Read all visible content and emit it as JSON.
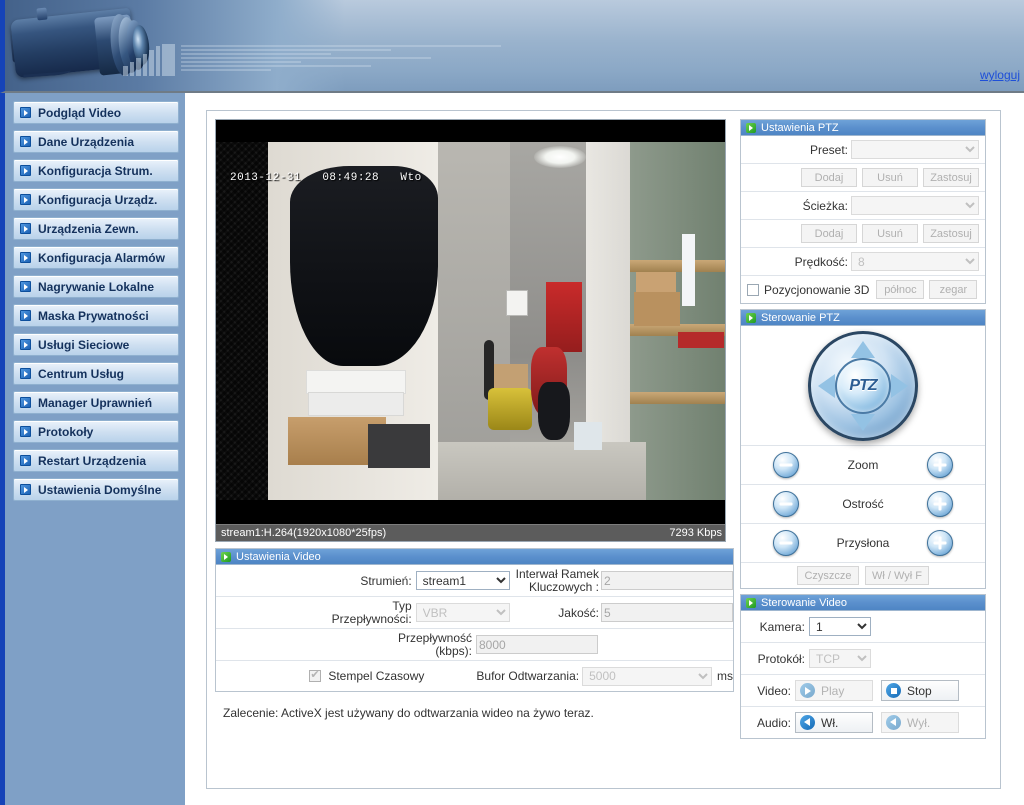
{
  "header": {
    "logo_icon": "camera-lens-image",
    "logout_label": "wyloguj"
  },
  "sidebar": {
    "items": [
      {
        "label": "Podgląd Video",
        "icon": "arrow-box-icon"
      },
      {
        "label": "Dane Urządzenia",
        "icon": "arrow-box-icon"
      },
      {
        "label": "Konfiguracja Strum.",
        "icon": "arrow-box-icon"
      },
      {
        "label": "Konfiguracja Urządz.",
        "icon": "arrow-box-icon"
      },
      {
        "label": "Urządzenia Zewn.",
        "icon": "arrow-box-icon"
      },
      {
        "label": "Konfiguracja Alarmów",
        "icon": "arrow-box-icon"
      },
      {
        "label": "Nagrywanie Lokalne",
        "icon": "arrow-box-icon"
      },
      {
        "label": "Maska Prywatności",
        "icon": "arrow-box-icon"
      },
      {
        "label": "Usługi Sieciowe",
        "icon": "arrow-box-icon"
      },
      {
        "label": "Centrum Usług",
        "icon": "arrow-box-icon"
      },
      {
        "label": "Manager Uprawnień",
        "icon": "arrow-box-icon"
      },
      {
        "label": "Protokoły",
        "icon": "arrow-box-icon"
      },
      {
        "label": "Restart Urządzenia",
        "icon": "arrow-box-icon"
      },
      {
        "label": "Ustawienia Domyślne",
        "icon": "arrow-box-icon"
      }
    ]
  },
  "video": {
    "timestamp_overlay": "2013-12-31   08:49:28   Wto",
    "stream_info": "stream1:H.264(1920x1080*25fps)",
    "bitrate": "7293 Kbps"
  },
  "ptz_settings": {
    "title": "Ustawienia PTZ",
    "preset_label": "Preset:",
    "preset_value": "",
    "preset_buttons": [
      "Dodaj",
      "Usuń",
      "Zastosuj"
    ],
    "path_label": "Ścieżka:",
    "path_value": "",
    "path_buttons": [
      "Dodaj",
      "Usuń",
      "Zastosuj"
    ],
    "speed_label": "Prędkość:",
    "speed_value": "8",
    "positioning_3d_label": "Pozycjonowanie 3D",
    "north_button": "północ",
    "clock_button": "zegar"
  },
  "ptz_control": {
    "title": "Sterowanie PTZ",
    "joystick_label": "PTZ",
    "zoom_label": "Zoom",
    "focus_label": "Ostrość",
    "iris_label": "Przysłona",
    "clean_button": "Czyszcze",
    "onoff_button": "Wł / Wył F"
  },
  "video_settings": {
    "title": "Ustawienia Video",
    "stream_label": "Strumień:",
    "stream_value": "stream1",
    "stream_options": [
      "stream1"
    ],
    "keyframe_label_line1": "Interwał Ramek",
    "keyframe_label_line2": "Kluczowych :",
    "keyframe_value": "2",
    "bitrate_type_label_line1": "Typ",
    "bitrate_type_label_line2": "Przepływności:",
    "bitrate_type_value": "VBR",
    "quality_label": "Jakość:",
    "quality_value": "5",
    "bitrate_label_line1": "Przepływność",
    "bitrate_label_line2": "(kbps):",
    "bitrate_value": "8000",
    "timestamp_label": "Stempel Czasowy",
    "timestamp_checked": true,
    "buffer_label": "Bufor Odtwarzania:",
    "buffer_value": "5000",
    "buffer_unit": "ms"
  },
  "video_control": {
    "title": "Sterowanie Video",
    "camera_label": "Kamera:",
    "camera_value": "1",
    "camera_options": [
      "1"
    ],
    "protocol_label": "Protokół:",
    "protocol_value": "TCP",
    "video_label": "Video:",
    "play_button": "Play",
    "stop_button": "Stop",
    "audio_label": "Audio:",
    "audio_on_button": "Wł.",
    "audio_off_button": "Wył."
  },
  "note": "Zalecenie: ActiveX jest używany do odtwarzania wideo na żywo teraz.",
  "colors": {
    "accent_blue": "#1543b8",
    "panel_header": "#4e85c4",
    "sidebar_bg": "#7fa0c6",
    "link": "#1e4fd8"
  }
}
